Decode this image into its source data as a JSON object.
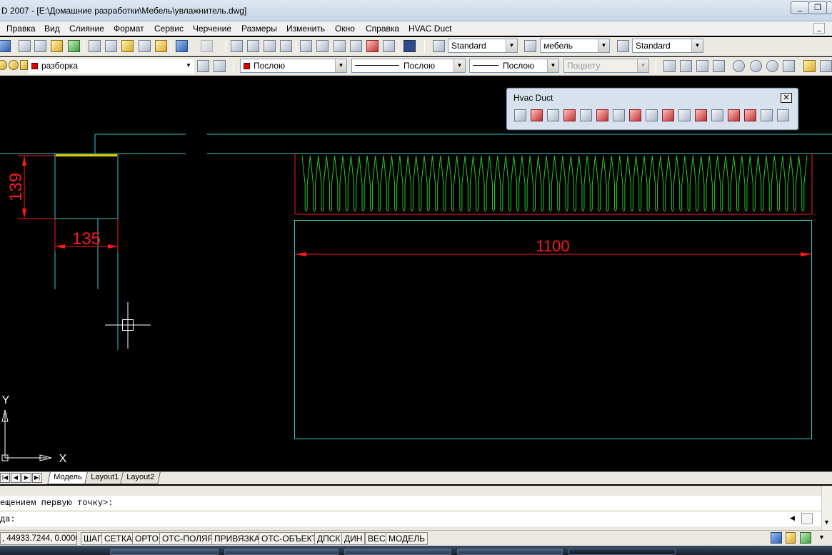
{
  "window": {
    "title": "D 2007 - [E:\\Домашние разработки\\Мебель\\увлажнитель.dwg]",
    "controls": [
      "minimize-icon",
      "restore-icon"
    ]
  },
  "menu": [
    "Правка",
    "Вид",
    "Слияние",
    "Формат",
    "Сервис",
    "Черчение",
    "Размеры",
    "Изменить",
    "Окно",
    "Справка",
    "HVAC Duct"
  ],
  "toolbar1": {
    "text_style": "Standard",
    "dim_style": "мебель",
    "table_style": "Standard"
  },
  "toolbar2": {
    "layer": "разборка",
    "color": "Послою",
    "linetype": "Послою",
    "lineweight": "Послою",
    "plotstyle": "Поцвету"
  },
  "palette": {
    "title": "Hvac Duct",
    "close": "✕"
  },
  "drawing": {
    "dim_vertical": "139",
    "dim_horizontal_small": "135",
    "dim_horizontal_large": "1100",
    "ucs_x": "X",
    "ucs_y": "Y",
    "colors": {
      "cyan": "#39c8c8",
      "red": "#ff1a1a",
      "green": "#22cc22",
      "yellow": "#e0d000",
      "white": "#ffffff"
    }
  },
  "layout_tabs": [
    "Модель",
    "Layout1",
    "Layout2"
  ],
  "command": {
    "history": "ещением первую точку>:",
    "prompt": "да:"
  },
  "status": {
    "coords": ", 44933.7244, 0.0000",
    "buttons": [
      "ШАГ",
      "СЕТКА",
      "ОРТО",
      "ОТС-ПОЛЯР",
      "ПРИВЯЗКА",
      "ОТС-ОБЪЕКТ",
      "ДПСК",
      "ДИН",
      "ВЕС",
      "МОДЕЛЬ"
    ]
  }
}
